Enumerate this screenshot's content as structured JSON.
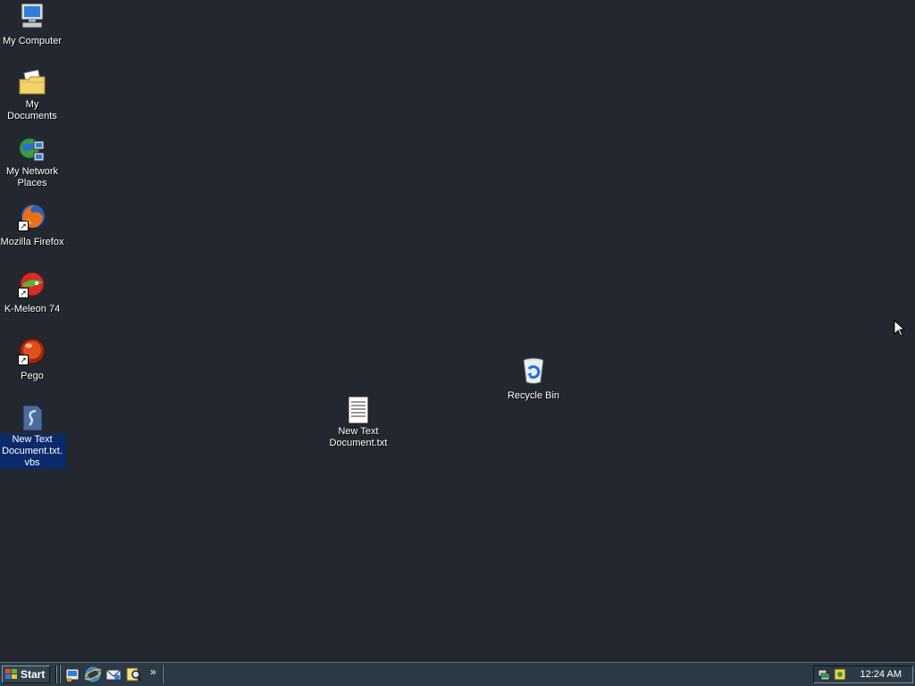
{
  "desktop": {
    "icons": [
      {
        "label": "My Computer",
        "icon": "my-computer-icon"
      },
      {
        "label": "My Documents",
        "icon": "my-documents-icon"
      },
      {
        "label": "My Network Places",
        "icon": "network-places-icon"
      },
      {
        "label": "Mozilla Firefox",
        "icon": "firefox-icon"
      },
      {
        "label": "K-Meleon 74",
        "icon": "k-meleon-icon"
      },
      {
        "label": "Pego",
        "icon": "pego-icon"
      },
      {
        "label": "New Text Document.txt.vbs",
        "icon": "vbs-script-icon"
      },
      {
        "label": "New Text Document.txt",
        "icon": "text-document-icon"
      },
      {
        "label": "Recycle Bin",
        "icon": "recycle-bin-icon"
      }
    ]
  },
  "taskbar": {
    "start_label": "Start",
    "quick_launch": [
      "show-desktop-icon",
      "internet-explorer-icon",
      "outlook-express-icon",
      "search-icon"
    ],
    "more_label": "»",
    "tray_icons": [
      "network-icon",
      "security-icon"
    ],
    "clock": "12:24 AM"
  },
  "colors": {
    "desktop_background": "#232830",
    "taskbar": "#2c3a45",
    "selection": "#0b2a6b"
  }
}
